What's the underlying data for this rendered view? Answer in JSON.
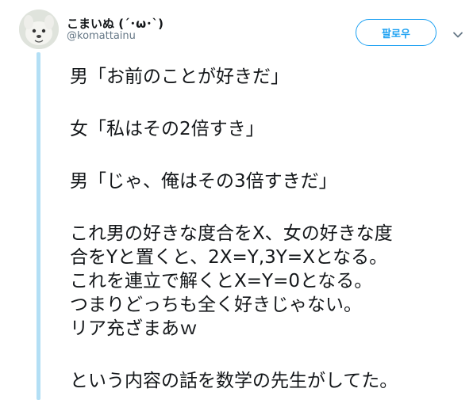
{
  "user": {
    "display_name": "こまいぬ (´･ω･`)",
    "handle": "@komattainu"
  },
  "header": {
    "follow_label": "팔로우",
    "menu_icon": "chevron-down-icon"
  },
  "tweet": {
    "lines": [
      "男「お前のことが好きだ」",
      "",
      "女「私はその2倍すき」",
      "",
      "男「じゃ、俺はその3倍すきだ」",
      "",
      "これ男の好きな度合をX、女の好きな度",
      "合をYと置くと、2X=Y,3Y=Xとなる。",
      "これを連立で解くとX=Y=0となる。",
      "つまりどっちも全く好きじゃない。",
      "リア充ざまあｗ",
      "",
      "という内容の話を数学の先生がしてた。"
    ]
  },
  "colors": {
    "accent": "#1da1f2",
    "thread_line": "#b3dff5",
    "handle_text": "#657786"
  }
}
